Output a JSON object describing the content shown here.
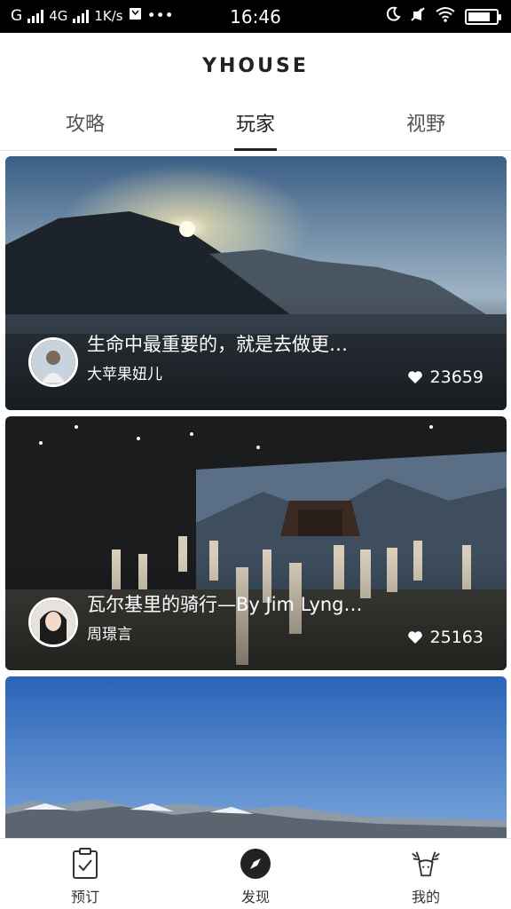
{
  "status_bar": {
    "carrier": "G",
    "network": "4G",
    "speed": "1K/s",
    "more": "•••",
    "time": "16:46"
  },
  "header": {
    "logo": "YHOUSE",
    "tabs": [
      {
        "label": "攻略",
        "active": false
      },
      {
        "label": "玩家",
        "active": true
      },
      {
        "label": "视野",
        "active": false
      }
    ]
  },
  "feed": {
    "cards": [
      {
        "title": "生命中最重要的，就是去做更…",
        "author": "大苹果妞儿",
        "likes": "23659",
        "image": "mountain-lake-sunset"
      },
      {
        "title": "瓦尔基里的骑行—By Jim Lyng…",
        "author": "周璟言",
        "likes": "25163",
        "image": "runway-fashion-show"
      },
      {
        "title": "",
        "author": "",
        "likes": "",
        "image": "blue-sky-snow-mountains"
      }
    ]
  },
  "bottom_nav": {
    "items": [
      {
        "label": "预订",
        "icon": "clipboard-check-icon"
      },
      {
        "label": "发现",
        "icon": "compass-icon"
      },
      {
        "label": "我的",
        "icon": "deer-antler-icon"
      }
    ]
  },
  "colors": {
    "status_bar_bg": "#000000",
    "text_primary": "#222222",
    "tab_indicator": "#222222"
  }
}
